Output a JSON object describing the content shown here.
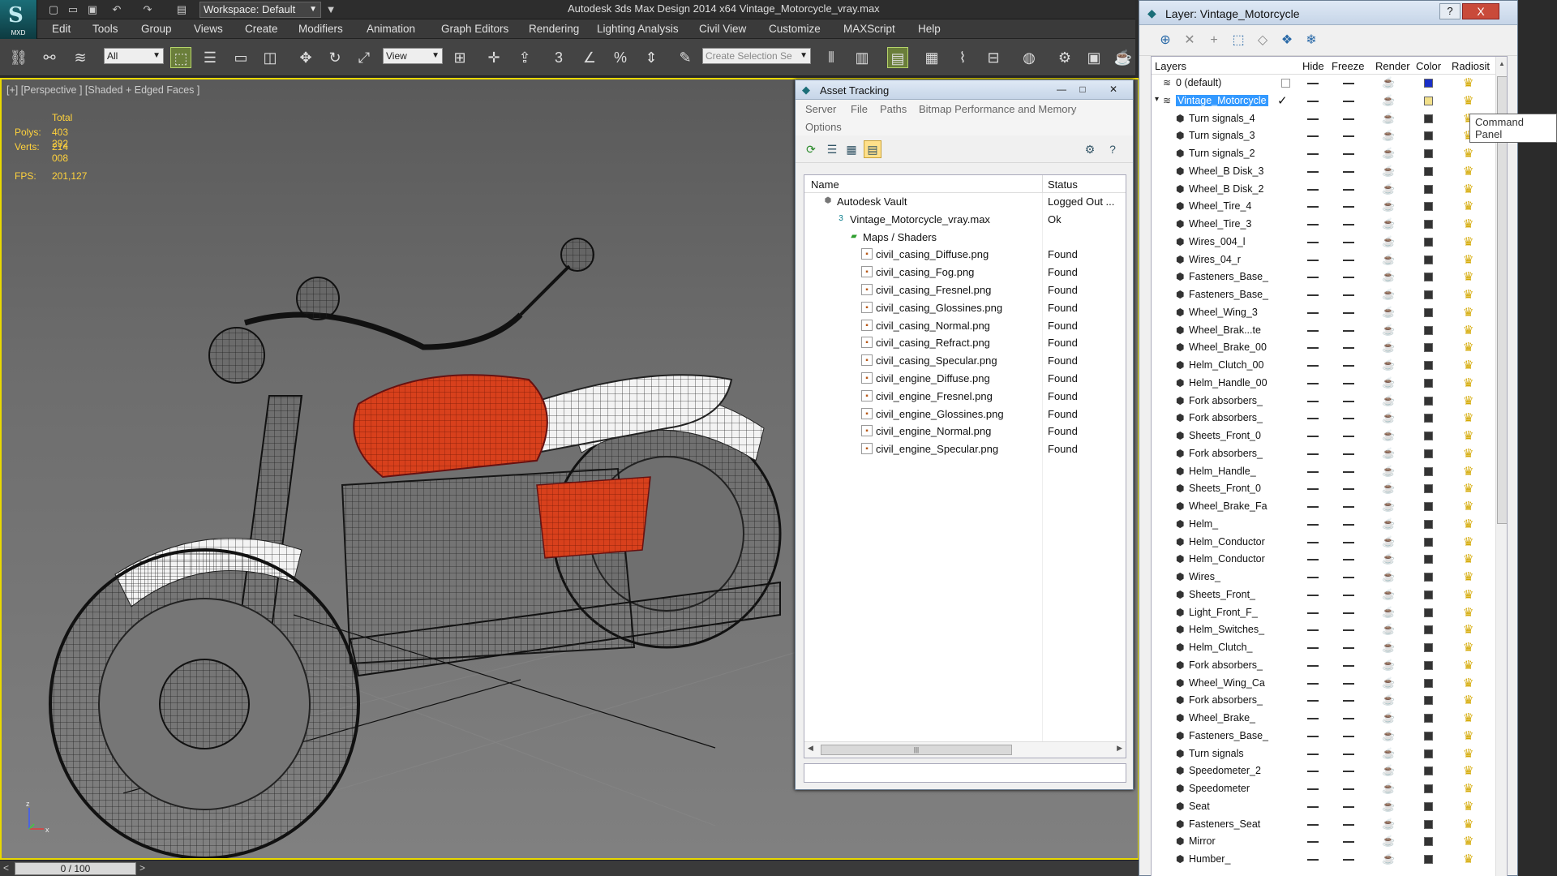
{
  "app": {
    "logo_text": "MXD",
    "title": "Autodesk 3ds Max Design 2014 x64     Vintage_Motorcycle_vray.max",
    "workspace": "Workspace: Default"
  },
  "menu": [
    "Edit",
    "Tools",
    "Group",
    "Views",
    "Create",
    "Modifiers",
    "Animation",
    "Graph Editors",
    "Rendering",
    "Lighting Analysis",
    "Civil View",
    "Customize",
    "MAXScript",
    "Help"
  ],
  "toolbar": {
    "filter_select": "All",
    "ref_coord_select": "View",
    "selection_set_placeholder": "Create Selection Se"
  },
  "viewport": {
    "label": "[+] [Perspective ] [Shaded + Edged Faces ]",
    "stats": {
      "total_label": "Total",
      "polys_label": "Polys:",
      "polys_value": "403 292",
      "verts_label": "Verts:",
      "verts_value": "214 008",
      "fps_label": "FPS:",
      "fps_value": "201,127"
    },
    "axis_labels": {
      "z": "z",
      "x": "x"
    }
  },
  "timeline": {
    "slider_text": "0 / 100",
    "next_arrow": ">"
  },
  "asset_tracking": {
    "title": "Asset Tracking",
    "menu": [
      "Server",
      "File",
      "Paths",
      "Bitmap Performance and Memory",
      "Options"
    ],
    "columns": [
      "Name",
      "Status"
    ],
    "rows": [
      {
        "name": "Autodesk Vault",
        "status": "Logged Out ...",
        "level": 0,
        "icon": "vault"
      },
      {
        "name": "Vintage_Motorcycle_vray.max",
        "status": "Ok",
        "level": 1,
        "icon": "max"
      },
      {
        "name": "Maps / Shaders",
        "status": "",
        "level": 2,
        "icon": "folder"
      },
      {
        "name": "civil_casing_Diffuse.png",
        "status": "Found",
        "level": 3,
        "icon": "file"
      },
      {
        "name": "civil_casing_Fog.png",
        "status": "Found",
        "level": 3,
        "icon": "file"
      },
      {
        "name": "civil_casing_Fresnel.png",
        "status": "Found",
        "level": 3,
        "icon": "file"
      },
      {
        "name": "civil_casing_Glossines.png",
        "status": "Found",
        "level": 3,
        "icon": "file"
      },
      {
        "name": "civil_casing_Normal.png",
        "status": "Found",
        "level": 3,
        "icon": "file"
      },
      {
        "name": "civil_casing_Refract.png",
        "status": "Found",
        "level": 3,
        "icon": "file"
      },
      {
        "name": "civil_casing_Specular.png",
        "status": "Found",
        "level": 3,
        "icon": "file"
      },
      {
        "name": "civil_engine_Diffuse.png",
        "status": "Found",
        "level": 3,
        "icon": "file"
      },
      {
        "name": "civil_engine_Fresnel.png",
        "status": "Found",
        "level": 3,
        "icon": "file"
      },
      {
        "name": "civil_engine_Glossines.png",
        "status": "Found",
        "level": 3,
        "icon": "file"
      },
      {
        "name": "civil_engine_Normal.png",
        "status": "Found",
        "level": 3,
        "icon": "file"
      },
      {
        "name": "civil_engine_Specular.png",
        "status": "Found",
        "level": 3,
        "icon": "file"
      }
    ]
  },
  "layer_manager": {
    "title": "Layer: Vintage_Motorcycle",
    "help_button": "?",
    "close_button": "X",
    "columns": [
      "Layers",
      "Hide",
      "Freeze",
      "Render",
      "Color",
      "Radiosit"
    ],
    "tooltip": "Command Panel",
    "layers": [
      {
        "name": "0 (default)",
        "type": "layer",
        "color": "#1a2fc8"
      },
      {
        "name": "Vintage_Motorcycle",
        "type": "layer",
        "selected": true,
        "active": true,
        "color": "#f2e08a"
      },
      {
        "name": "Turn signals_4",
        "type": "object",
        "color": "#333333"
      },
      {
        "name": "Turn signals_3",
        "type": "object",
        "color": "#333333"
      },
      {
        "name": "Turn signals_2",
        "type": "object",
        "color": "#333333"
      },
      {
        "name": "Wheel_B Disk_3",
        "type": "object",
        "color": "#333333"
      },
      {
        "name": "Wheel_B Disk_2",
        "type": "object",
        "color": "#333333"
      },
      {
        "name": "Wheel_Tire_4",
        "type": "object",
        "color": "#333333"
      },
      {
        "name": "Wheel_Tire_3",
        "type": "object",
        "color": "#333333"
      },
      {
        "name": "Wires_004_l",
        "type": "object",
        "color": "#333333"
      },
      {
        "name": "Wires_04_r",
        "type": "object",
        "color": "#333333"
      },
      {
        "name": "Fasteners_Base_",
        "type": "object",
        "color": "#333333"
      },
      {
        "name": "Fasteners_Base_",
        "type": "object",
        "color": "#333333"
      },
      {
        "name": "Wheel_Wing_3",
        "type": "object",
        "color": "#333333"
      },
      {
        "name": "Wheel_Brak...te",
        "type": "object",
        "color": "#333333"
      },
      {
        "name": "Wheel_Brake_00",
        "type": "object",
        "color": "#333333"
      },
      {
        "name": "Helm_Clutch_00",
        "type": "object",
        "color": "#333333"
      },
      {
        "name": "Helm_Handle_00",
        "type": "object",
        "color": "#333333"
      },
      {
        "name": "Fork absorbers_",
        "type": "object",
        "color": "#333333"
      },
      {
        "name": "Fork absorbers_",
        "type": "object",
        "color": "#333333"
      },
      {
        "name": "Sheets_Front_0",
        "type": "object",
        "color": "#333333"
      },
      {
        "name": "Fork absorbers_",
        "type": "object",
        "color": "#333333"
      },
      {
        "name": "Helm_Handle_",
        "type": "object",
        "color": "#333333"
      },
      {
        "name": "Sheets_Front_0",
        "type": "object",
        "color": "#333333"
      },
      {
        "name": "Wheel_Brake_Fa",
        "type": "object",
        "color": "#333333"
      },
      {
        "name": "Helm_",
        "type": "object",
        "color": "#333333"
      },
      {
        "name": "Helm_Conductor",
        "type": "object",
        "color": "#333333"
      },
      {
        "name": "Helm_Conductor",
        "type": "object",
        "color": "#333333"
      },
      {
        "name": "Wires_",
        "type": "object",
        "color": "#333333"
      },
      {
        "name": "Sheets_Front_",
        "type": "object",
        "color": "#333333"
      },
      {
        "name": "Light_Front_F_",
        "type": "object",
        "color": "#333333"
      },
      {
        "name": "Helm_Switches_",
        "type": "object",
        "color": "#333333"
      },
      {
        "name": "Helm_Clutch_",
        "type": "object",
        "color": "#333333"
      },
      {
        "name": "Fork absorbers_",
        "type": "object",
        "color": "#333333"
      },
      {
        "name": "Wheel_Wing_Ca",
        "type": "object",
        "color": "#333333"
      },
      {
        "name": "Fork absorbers_",
        "type": "object",
        "color": "#333333"
      },
      {
        "name": "Wheel_Brake_",
        "type": "object",
        "color": "#333333"
      },
      {
        "name": "Fasteners_Base_",
        "type": "object",
        "color": "#333333"
      },
      {
        "name": "Turn signals",
        "type": "object",
        "color": "#333333"
      },
      {
        "name": "Speedometer_2",
        "type": "object",
        "color": "#333333"
      },
      {
        "name": "Speedometer",
        "type": "object",
        "color": "#333333"
      },
      {
        "name": "Seat",
        "type": "object",
        "color": "#333333"
      },
      {
        "name": "Fasteners_Seat",
        "type": "object",
        "color": "#333333"
      },
      {
        "name": "Mirror",
        "type": "object",
        "color": "#333333"
      },
      {
        "name": "Humber_",
        "type": "object",
        "color": "#333333"
      }
    ]
  }
}
